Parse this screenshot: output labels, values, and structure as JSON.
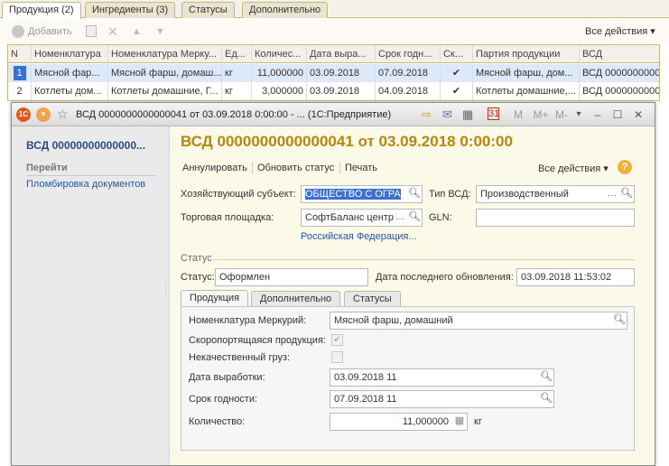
{
  "bg": {
    "tabs": [
      "Продукция (2)",
      "Ингредиенты (3)",
      "Статусы",
      "Дополнительно"
    ],
    "toolbar": {
      "add": "Добавить",
      "all_actions": "Все действия ▾"
    },
    "columns": [
      "N",
      "Номенклатура",
      "Номенклатура Мерку...",
      "Ед...",
      "Количес...",
      "Дата выра...",
      "Срок годн...",
      "Ск...",
      "Партия продукции",
      "ВСД"
    ],
    "rows": [
      [
        "1",
        "Мясной фар...",
        "Мясной фарш, домаш...",
        "кг",
        "11,000000",
        "03.09.2018",
        "07.09.2018",
        "✔",
        "Мясной фарш, дом...",
        "ВСД 000000000000"
      ],
      [
        "2",
        "Котлеты дом...",
        "Котлеты домашние, Г...",
        "кг",
        "3,000000",
        "03.09.2018",
        "04.09.2018",
        "✔",
        "Котлеты домашние,...",
        "ВСД 000000000000"
      ]
    ]
  },
  "window": {
    "title": "ВСД 0000000000000041 от 03.09.2018 0:00:00 - ...  (1С:Предприятие)",
    "title_buttons": [
      "M",
      "M+",
      "M-"
    ]
  },
  "sidebar": {
    "doc_title": "ВСД 00000000000000...",
    "goto": "Перейти",
    "link": "Пломбировка документов"
  },
  "form": {
    "heading": "ВСД 0000000000000041 от 03.09.2018 0:00:00",
    "actions": {
      "annul": "Аннулировать",
      "refresh": "Обновить статус",
      "print": "Печать",
      "all": "Все действия ▾",
      "help": "?"
    },
    "entity_label": "Хозяйствующий субъект:",
    "entity_value": "ОБЩЕСТВО С ОГРА",
    "vsd_type_label": "Тип ВСД:",
    "vsd_type_value": "Производственный",
    "site_label": "Торговая площадка:",
    "site_value": "СофтБаланс центр",
    "gln_label": "GLN:",
    "gln_value": "",
    "country_link": "Российская Федерация...",
    "status_group": "Статус",
    "status_label": "Статус:",
    "status_value": "Оформлен",
    "updated_label": "Дата последнего обновления:",
    "updated_value": "03.09.2018 11:53:02",
    "tabs": [
      "Продукция",
      "Дополнительно",
      "Статусы"
    ],
    "nom_label": "Номенклатура Меркурий:",
    "nom_value": "Мясной фарш, домашний",
    "perishable_label": "Скоропортящаяся продукция:",
    "lowquality_label": "Некачественный груз:",
    "prod_date_label": "Дата выработки:",
    "prod_date_value": "03.09.2018 11",
    "expiry_label": "Срок годности:",
    "expiry_value": "07.09.2018 11",
    "qty_label": "Количество:",
    "qty_value": "11,000000",
    "qty_unit": "кг"
  }
}
